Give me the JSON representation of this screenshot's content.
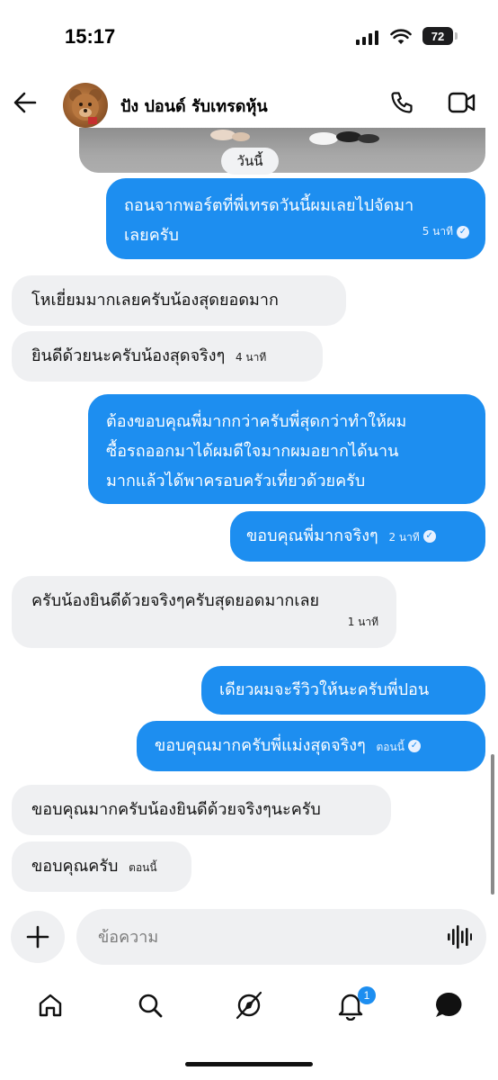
{
  "status_bar": {
    "time": "15:17",
    "battery": "72"
  },
  "header": {
    "contact_name": "ปัง ปอนด์ รับเทรดหุ้น"
  },
  "conversation": {
    "date_divider": "วันนี้",
    "messages": [
      {
        "side": "out",
        "lines": [
          "ถอนจากพอร์ตที่พี่เทรดวันนี้ผมเลยไปจัดมา",
          "เลยครับ"
        ],
        "time": "5 นาที",
        "read": true
      },
      {
        "side": "in",
        "lines": [
          "โหเยี่ยมมากเลยครับน้องสุดยอดมาก"
        ]
      },
      {
        "side": "in",
        "lines": [
          "ยินดีด้วยนะครับน้องสุดจริงๆ"
        ],
        "time": "4 นาที"
      },
      {
        "side": "out",
        "lines": [
          "ต้องขอบคุณพี่มากกว่าครับพี่สุดกว่าทำให้ผม",
          "ซื้อรถออกมาได้ผมดีใจมากผมอยากได้นาน",
          "มากแล้วได้พาครอบครัวเที่ยวด้วยครับ"
        ]
      },
      {
        "side": "out",
        "lines": [
          "ขอบคุณพี่มากจริงๆ"
        ],
        "time": "2 นาที",
        "read": true
      },
      {
        "side": "in",
        "lines": [
          "ครับน้องยินดีด้วยจริงๆครับสุดยอดมากเลย"
        ],
        "time": "1 นาที"
      },
      {
        "side": "out",
        "lines": [
          "เดียวผมจะรีวิวให้นะครับพี่ปอน"
        ]
      },
      {
        "side": "out",
        "lines": [
          "ขอบคุณมากครับพี่แม่งสุดจริงๆ"
        ],
        "time": "ตอนนี้",
        "read": true
      },
      {
        "side": "in",
        "lines": [
          "ขอบคุณมากครับน้องยินดีด้วยจริงๆนะครับ"
        ]
      },
      {
        "side": "in",
        "lines": [
          "ขอบคุณครับ"
        ],
        "time": "ตอนนี้"
      }
    ]
  },
  "composer": {
    "placeholder": "ข้อความ"
  },
  "bottom_nav": {
    "items": [
      "home",
      "search",
      "explore",
      "notifications",
      "messages"
    ],
    "notification_count": "1"
  },
  "colors": {
    "outgoing": "#1d8ef0",
    "incoming": "#eff0f2",
    "accent": "#1d8ef0"
  }
}
